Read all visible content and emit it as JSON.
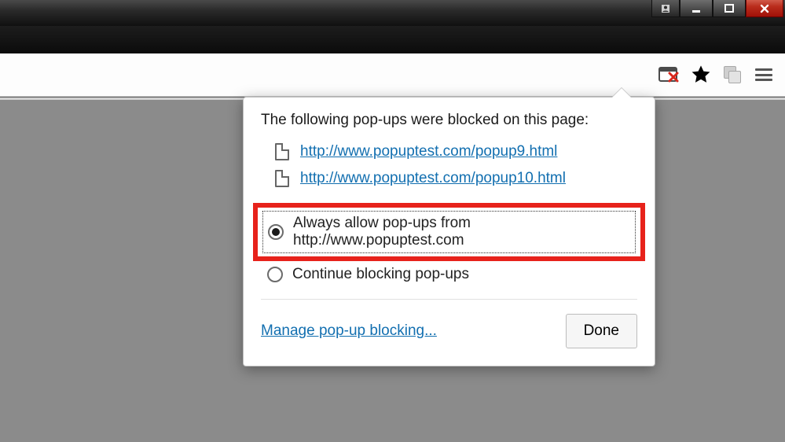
{
  "bubble": {
    "heading": "The following pop-ups were blocked on this page:",
    "blocked": [
      "http://www.popuptest.com/popup9.html",
      "http://www.popuptest.com/popup10.html"
    ],
    "option_allow": "Always allow pop-ups from http://www.popuptest.com",
    "option_block": "Continue blocking pop-ups",
    "manage_link": "Manage pop-up blocking...",
    "done": "Done"
  }
}
